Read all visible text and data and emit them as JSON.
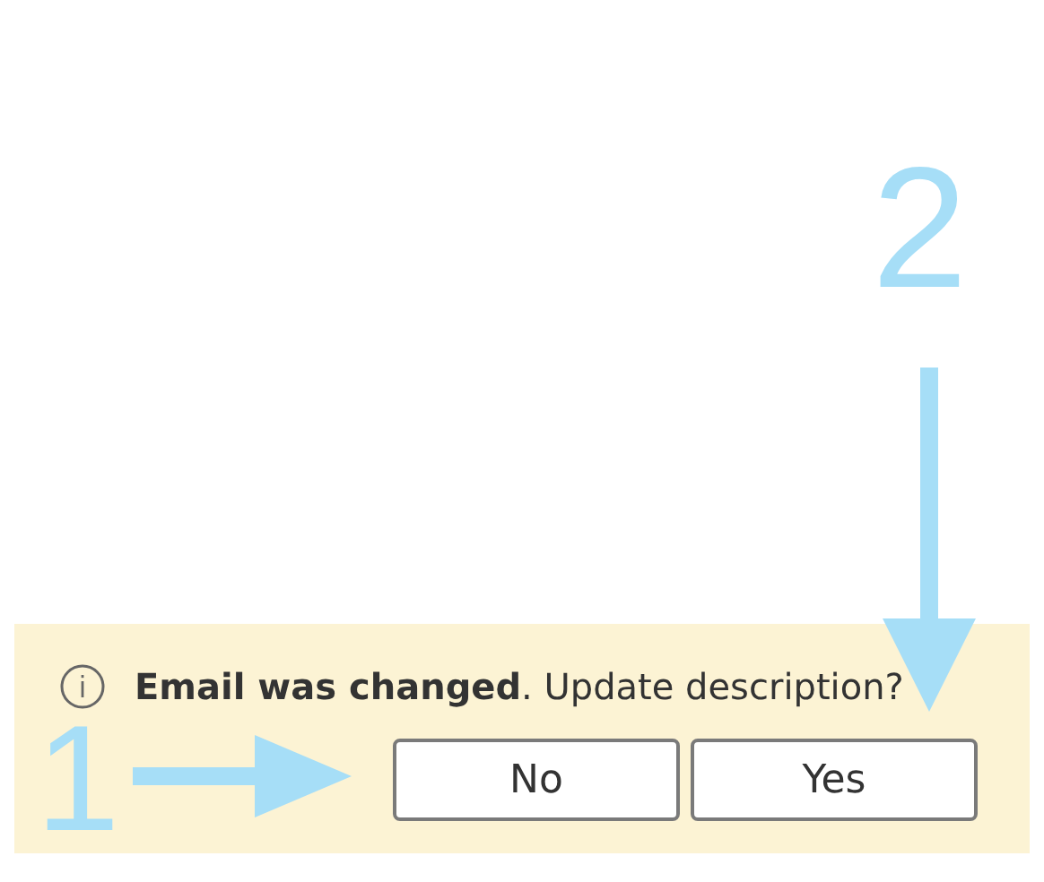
{
  "notification": {
    "message": "**Email was changed**. Update description?",
    "buttons": [
      "No",
      "Yes"
    ]
  },
  "annotations": [
    {
      "label": "1",
      "kind": "right"
    },
    {
      "label": "2",
      "kind": "down"
    }
  ]
}
